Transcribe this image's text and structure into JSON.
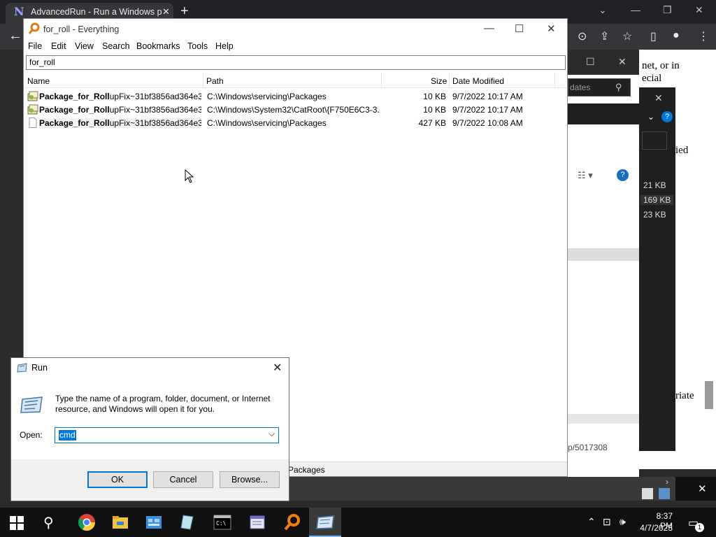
{
  "browser": {
    "tab_title": "AdvancedRun - Run a Windows p",
    "tab_icon": "N",
    "page_snippets": {
      "line1": "net, or in",
      "line2": "ecial",
      "line3": "ied",
      "line4": "riate"
    },
    "sizes": [
      "21 KB",
      "169 KB",
      "23 KB"
    ],
    "link_text": "p/5017308",
    "search_placeholder": "dates"
  },
  "everything": {
    "title": "for_roll - Everything",
    "menu": [
      "File",
      "Edit",
      "View",
      "Search",
      "Bookmarks",
      "Tools",
      "Help"
    ],
    "search_value": "for_roll",
    "columns": [
      "Name",
      "Path",
      "Size",
      "Date Modified"
    ],
    "rows": [
      {
        "name_bold": "Package_for_Roll",
        "name_rest": "upFix~31bf3856ad364e3...",
        "path": "C:\\Windows\\servicing\\Packages",
        "size": "10 KB",
        "date": "9/7/2022 10:17 AM",
        "icon": "package-cert-icon"
      },
      {
        "name_bold": "Package_for_Roll",
        "name_rest": "upFix~31bf3856ad364e3...",
        "path": "C:\\Windows\\System32\\CatRoot\\{F750E6C3-3...",
        "size": "10 KB",
        "date": "9/7/2022 10:17 AM",
        "icon": "package-cert-icon"
      },
      {
        "name_bold": "Package_for_Roll",
        "name_rest": "upFix~31bf3856ad364e3...",
        "path": "C:\\Windows\\servicing\\Packages",
        "size": "427 KB",
        "date": "9/7/2022 10:08 AM",
        "icon": "blank-file-icon"
      }
    ],
    "status_text": "Packages"
  },
  "run_dialog": {
    "title": "Run",
    "description": "Type the name of a program, folder, document, or Internet resource, and Windows will open it for you.",
    "open_label": "Open:",
    "input_value": "cmd",
    "ok_label": "OK",
    "cancel_label": "Cancel",
    "browse_label": "Browse..."
  },
  "taskbar": {
    "time": "8:37 PM",
    "date": "4/7/2023",
    "notification_count": "1"
  }
}
